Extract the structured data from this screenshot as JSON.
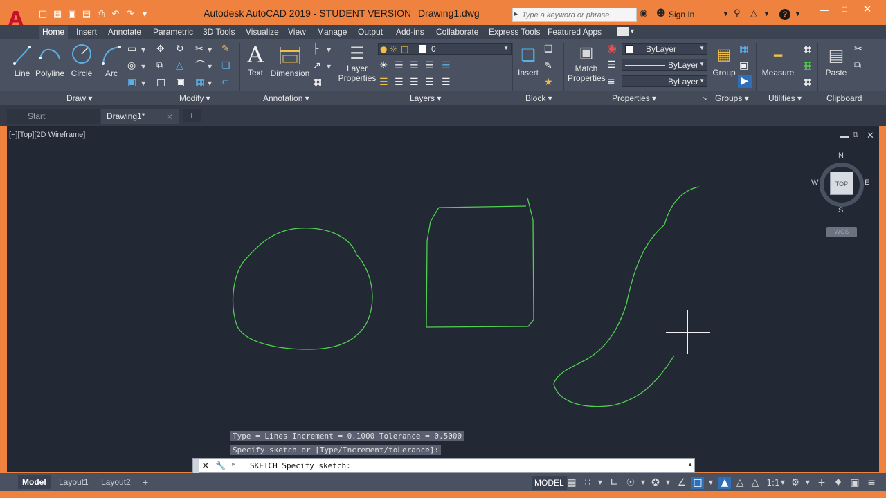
{
  "title_bar": {
    "app_title": "Autodesk AutoCAD 2019 - STUDENT VERSION",
    "document_name": "Drawing1.dwg",
    "search_placeholder": "Type a keyword or phrase",
    "sign_in": "Sign In",
    "logo_letter": "A"
  },
  "ribbon": {
    "tabs": [
      "Home",
      "Insert",
      "Annotate",
      "Parametric",
      "3D Tools",
      "Visualize",
      "View",
      "Manage",
      "Output",
      "Add-ins",
      "Collaborate",
      "Express Tools",
      "Featured Apps"
    ],
    "active_tab": "Home",
    "draw": {
      "line": "Line",
      "polyline": "Polyline",
      "circle": "Circle",
      "arc": "Arc"
    },
    "annotation": {
      "text": "Text",
      "dimension": "Dimension"
    },
    "layers": {
      "layer_properties_1": "Layer",
      "layer_properties_2": "Properties",
      "current_layer": "0"
    },
    "block": {
      "insert": "Insert"
    },
    "properties": {
      "match_1": "Match",
      "match_2": "Properties",
      "color": "ByLayer",
      "linetype": "ByLayer",
      "lineweight": "ByLayer"
    },
    "groups": {
      "group": "Group"
    },
    "utilities": {
      "measure": "Measure"
    },
    "clipboard": {
      "paste": "Paste"
    },
    "panel_titles": [
      "Draw",
      "Modify",
      "Annotation",
      "Layers",
      "Block",
      "Properties",
      "Groups",
      "Utilities",
      "Clipboard"
    ]
  },
  "file_tabs": {
    "start": "Start",
    "drawing": "Drawing1*"
  },
  "viewport": {
    "label": "[−][Top][2D Wireframe]",
    "viewcube": {
      "top": "TOP",
      "n": "N",
      "s": "S",
      "w": "W",
      "e": "E",
      "wcs": "WCS"
    }
  },
  "command": {
    "history_1": "Type = Lines  Increment = 0.1000  Tolerance = 0.5000",
    "history_2": "Specify sketch or [Type/Increment/toLerance]:",
    "current": "SKETCH Specify sketch:"
  },
  "status_bar": {
    "layout_tabs": [
      "Model",
      "Layout1",
      "Layout2"
    ],
    "model_space": "MODEL",
    "scale": "1:1"
  },
  "colors": {
    "accent": "#f0823f",
    "sketch_line": "#4fd14f",
    "canvas": "#222834"
  }
}
